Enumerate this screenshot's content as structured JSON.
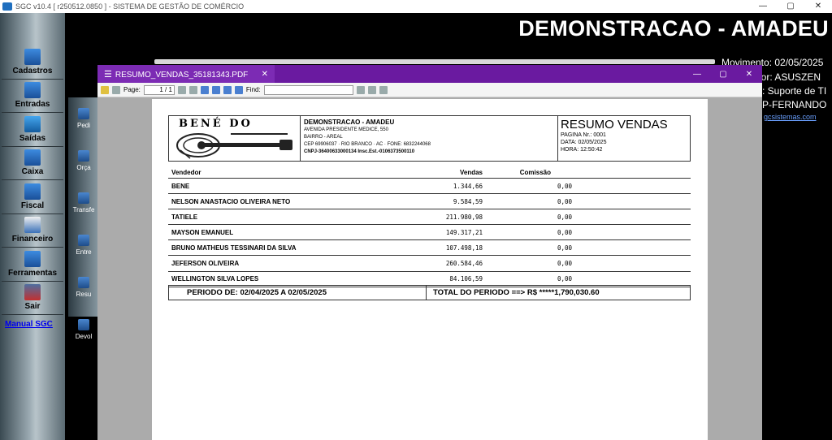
{
  "app": {
    "title": "SGC v10.4 [ r250512.0850 ] - SISTEMA DE GESTÃO DE COMÉRCIO",
    "win_min": "—",
    "win_max": "▢",
    "win_close": "✕"
  },
  "sidebar": {
    "items": [
      {
        "label": "Cadastros"
      },
      {
        "label": "Entradas"
      },
      {
        "label": "Saídas"
      },
      {
        "label": "Caixa"
      },
      {
        "label": "Fiscal"
      },
      {
        "label": "Financeiro"
      },
      {
        "label": "Ferramentas"
      },
      {
        "label": "Sair"
      }
    ],
    "manual": "Manual SGC"
  },
  "submenu": {
    "items": [
      {
        "label": "Pedi"
      },
      {
        "label": "Orça"
      },
      {
        "label": "Transfe"
      },
      {
        "label": "Entre"
      },
      {
        "label": "Resu"
      },
      {
        "label": "Devol"
      }
    ]
  },
  "header": {
    "company": "DEMONSTRACAO - AMADEU",
    "movimento": "Movimento: 02/05/2025",
    "operador": "dor: ASUSZEN",
    "suporte": ": Suporte de TI",
    "user": "P-FERNANDO",
    "link": "gcsistemas.com"
  },
  "pdf": {
    "tab_title": "RESUMO_VENDAS_35181343.PDF",
    "tab_close": "✕",
    "toolbar": {
      "page_label": "Page:",
      "page_value": "1 / 1",
      "find_label": "Find:"
    },
    "report": {
      "logo": "BENÉ DO",
      "company_name": "DEMONSTRACAO - AMADEU",
      "address": "AVENIDA PRESIDENTE MEDICE, 550",
      "district": "BAIRRO - AREAL",
      "cep_line": "CEP 69906037 · RIO BRANCO · AC · FONE: 6832244068",
      "cnpj_line": "CNPJ-36400633000134   Insc.Est.-0106373500110",
      "title": "RESUMO VENDAS",
      "pagina": "PAGINA Nr.: 0001",
      "data": "DATA: 02/05/2025",
      "hora": "HORA: 12:50:42",
      "columns": {
        "vendedor": "Vendedor",
        "vendas": "Vendas",
        "comissao": "Comissão"
      },
      "rows": [
        {
          "vendedor": "BENE",
          "vendas": "1.344,66",
          "comissao": "0,00"
        },
        {
          "vendedor": "NELSON ANASTACIO OLIVEIRA NETO",
          "vendas": "9.584,59",
          "comissao": "0,00"
        },
        {
          "vendedor": "TATIELE",
          "vendas": "211.980,98",
          "comissao": "0,00"
        },
        {
          "vendedor": "MAYSON EMANUEL",
          "vendas": "149.317,21",
          "comissao": "0,00"
        },
        {
          "vendedor": "BRUNO MATHEUS TESSINARI DA SILVA",
          "vendas": "107.498,18",
          "comissao": "0,00"
        },
        {
          "vendedor": "JEFERSON OLIVEIRA",
          "vendas": "260.584,46",
          "comissao": "0,00"
        },
        {
          "vendedor": "WELLINGTON SILVA LOPES",
          "vendas": "84.106,59",
          "comissao": "0,00"
        }
      ],
      "periodo": "PERIODO DE: 02/04/2025 A 02/05/2025",
      "total": "TOTAL DO PERIODO ==> R$ *****1,790,030.60"
    }
  }
}
